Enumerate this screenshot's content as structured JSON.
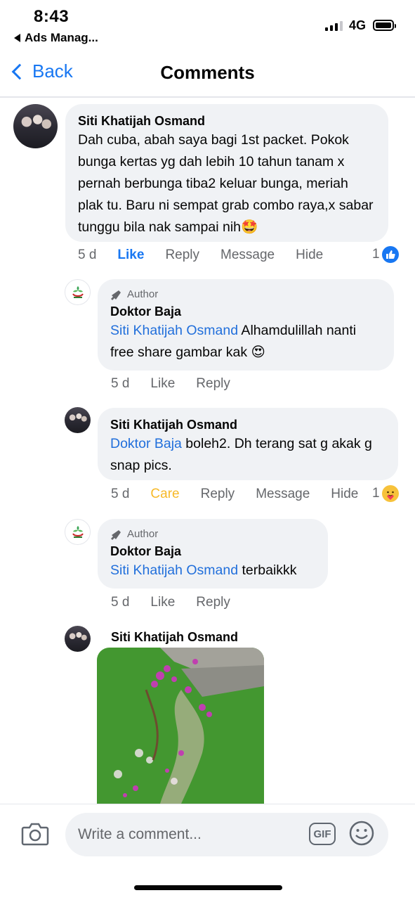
{
  "status_bar": {
    "time": "8:43",
    "back_app": "Ads Manag...",
    "network": "4G"
  },
  "nav": {
    "back": "Back",
    "title": "Comments"
  },
  "comments": [
    {
      "name": "Siti Khatijah Osmand",
      "text": "Dah cuba, abah saya bagi 1st packet. Pokok bunga kertas yg dah lebih 10 tahun tanam x pernah berbunga tiba2 keluar bunga, meriah plak tu. Baru ni sempat grab combo raya,x sabar tunggu bila nak sampai nih🤩",
      "time": "5 d",
      "like": "Like",
      "reply": "Reply",
      "message": "Message",
      "hide": "Hide",
      "reaction_count": "1"
    },
    {
      "author_badge": "Author",
      "name": "Doktor Baja",
      "mention": "Siti Khatijah Osmand",
      "text": " Alhamdulillah nanti free share gambar kak 😍",
      "time": "5 d",
      "like": "Like",
      "reply": "Reply"
    },
    {
      "name": "Siti Khatijah Osmand",
      "mention": "Doktor Baja",
      "text": " boleh2. Dh terang sat g akak g snap pics.",
      "time": "5 d",
      "care": "Care",
      "reply": "Reply",
      "message": "Message",
      "hide": "Hide",
      "reaction_count": "1"
    },
    {
      "author_badge": "Author",
      "name": "Doktor Baja",
      "mention": "Siti Khatijah Osmand",
      "text": " terbaikkk",
      "time": "5 d",
      "like": "Like",
      "reply": "Reply"
    },
    {
      "name": "Siti Khatijah Osmand"
    }
  ],
  "composer": {
    "placeholder": "Write a comment...",
    "gif": "GIF"
  }
}
